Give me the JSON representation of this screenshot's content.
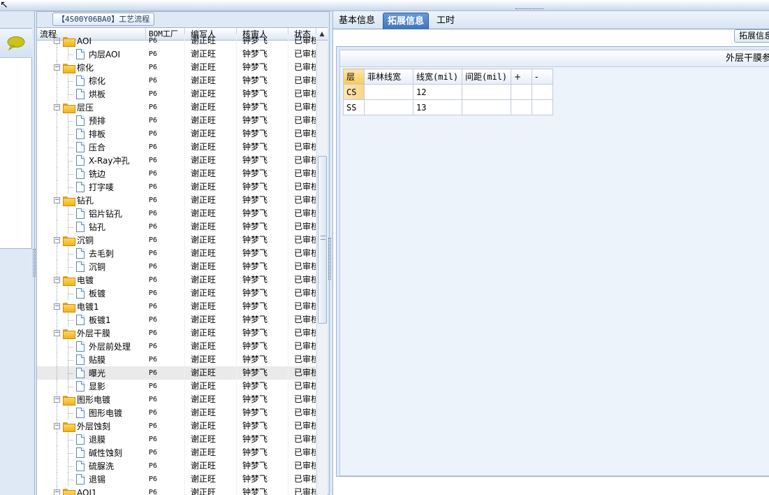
{
  "tree_panel": {
    "title": "【4S00Y06BA0】工艺流程",
    "columns": [
      "流程",
      "BOM工厂",
      "编写人",
      "核审人",
      "状态"
    ],
    "rows": [
      {
        "name": "AOI",
        "level": 0,
        "type": "folder",
        "bom": "P6",
        "writer": "谢正旺",
        "reviewer": "钟梦飞",
        "status": "已审核"
      },
      {
        "name": "内层AOI",
        "level": 1,
        "type": "doc",
        "bom": "P6",
        "writer": "谢正旺",
        "reviewer": "钟梦飞",
        "status": "已审核"
      },
      {
        "name": "棕化",
        "level": 0,
        "type": "folder",
        "bom": "P6",
        "writer": "谢正旺",
        "reviewer": "钟梦飞",
        "status": "已审核"
      },
      {
        "name": "棕化",
        "level": 1,
        "type": "doc",
        "bom": "P6",
        "writer": "谢正旺",
        "reviewer": "钟梦飞",
        "status": "已审核"
      },
      {
        "name": "烘板",
        "level": 1,
        "type": "doc",
        "bom": "P6",
        "writer": "谢正旺",
        "reviewer": "钟梦飞",
        "status": "已审核"
      },
      {
        "name": "层压",
        "level": 0,
        "type": "folder",
        "bom": "P6",
        "writer": "谢正旺",
        "reviewer": "钟梦飞",
        "status": "已审核"
      },
      {
        "name": "预排",
        "level": 1,
        "type": "doc",
        "bom": "P6",
        "writer": "谢正旺",
        "reviewer": "钟梦飞",
        "status": "已审核"
      },
      {
        "name": "排板",
        "level": 1,
        "type": "doc",
        "bom": "P6",
        "writer": "谢正旺",
        "reviewer": "钟梦飞",
        "status": "已审核"
      },
      {
        "name": "压合",
        "level": 1,
        "type": "doc",
        "bom": "P6",
        "writer": "谢正旺",
        "reviewer": "钟梦飞",
        "status": "已审核"
      },
      {
        "name": "X-Ray冲孔",
        "level": 1,
        "type": "doc",
        "bom": "P6",
        "writer": "谢正旺",
        "reviewer": "钟梦飞",
        "status": "已审核"
      },
      {
        "name": "铣边",
        "level": 1,
        "type": "doc",
        "bom": "P6",
        "writer": "谢正旺",
        "reviewer": "钟梦飞",
        "status": "已审核"
      },
      {
        "name": "打字唛",
        "level": 1,
        "type": "doc",
        "bom": "P6",
        "writer": "谢正旺",
        "reviewer": "钟梦飞",
        "status": "已审核"
      },
      {
        "name": "钻孔",
        "level": 0,
        "type": "folder",
        "bom": "P6",
        "writer": "谢正旺",
        "reviewer": "钟梦飞",
        "status": "已审核"
      },
      {
        "name": "铝片钻孔",
        "level": 1,
        "type": "doc",
        "bom": "P6",
        "writer": "谢正旺",
        "reviewer": "钟梦飞",
        "status": "已审核"
      },
      {
        "name": "钻孔",
        "level": 1,
        "type": "doc",
        "bom": "P6",
        "writer": "谢正旺",
        "reviewer": "钟梦飞",
        "status": "已审核"
      },
      {
        "name": "沉铜",
        "level": 0,
        "type": "folder",
        "bom": "P6",
        "writer": "谢正旺",
        "reviewer": "钟梦飞",
        "status": "已审核"
      },
      {
        "name": "去毛刺",
        "level": 1,
        "type": "doc",
        "bom": "P6",
        "writer": "谢正旺",
        "reviewer": "钟梦飞",
        "status": "已审核"
      },
      {
        "name": "沉铜",
        "level": 1,
        "type": "doc",
        "bom": "P6",
        "writer": "谢正旺",
        "reviewer": "钟梦飞",
        "status": "已审核"
      },
      {
        "name": "电镀",
        "level": 0,
        "type": "folder",
        "bom": "P6",
        "writer": "谢正旺",
        "reviewer": "钟梦飞",
        "status": "已审核"
      },
      {
        "name": "板镀",
        "level": 1,
        "type": "doc",
        "bom": "P6",
        "writer": "谢正旺",
        "reviewer": "钟梦飞",
        "status": "已审核"
      },
      {
        "name": "电镀1",
        "level": 0,
        "type": "folder",
        "bom": "P6",
        "writer": "谢正旺",
        "reviewer": "钟梦飞",
        "status": "已审核"
      },
      {
        "name": "板镀1",
        "level": 1,
        "type": "doc",
        "bom": "P6",
        "writer": "谢正旺",
        "reviewer": "钟梦飞",
        "status": "已审核"
      },
      {
        "name": "外层干膜",
        "level": 0,
        "type": "folder",
        "bom": "P6",
        "writer": "谢正旺",
        "reviewer": "钟梦飞",
        "status": "已审核"
      },
      {
        "name": "外层前处理",
        "level": 1,
        "type": "doc",
        "bom": "P6",
        "writer": "谢正旺",
        "reviewer": "钟梦飞",
        "status": "已审核"
      },
      {
        "name": "贴膜",
        "level": 1,
        "type": "doc",
        "bom": "P6",
        "writer": "谢正旺",
        "reviewer": "钟梦飞",
        "status": "已审核"
      },
      {
        "name": "曝光",
        "level": 1,
        "type": "doc",
        "bom": "P6",
        "writer": "谢正旺",
        "reviewer": "钟梦飞",
        "status": "已审核",
        "highlighted": true
      },
      {
        "name": "显影",
        "level": 1,
        "type": "doc",
        "bom": "P6",
        "writer": "谢正旺",
        "reviewer": "钟梦飞",
        "status": "已审核"
      },
      {
        "name": "图形电镀",
        "level": 0,
        "type": "folder",
        "bom": "P6",
        "writer": "谢正旺",
        "reviewer": "钟梦飞",
        "status": "已审核"
      },
      {
        "name": "图形电镀",
        "level": 1,
        "type": "doc",
        "bom": "P6",
        "writer": "谢正旺",
        "reviewer": "钟梦飞",
        "status": "已审核"
      },
      {
        "name": "外层蚀刻",
        "level": 0,
        "type": "folder",
        "bom": "P6",
        "writer": "谢正旺",
        "reviewer": "钟梦飞",
        "status": "已审核"
      },
      {
        "name": "退膜",
        "level": 1,
        "type": "doc",
        "bom": "P6",
        "writer": "谢正旺",
        "reviewer": "钟梦飞",
        "status": "已审核"
      },
      {
        "name": "碱性蚀刻",
        "level": 1,
        "type": "doc",
        "bom": "P6",
        "writer": "谢正旺",
        "reviewer": "钟梦飞",
        "status": "已审核"
      },
      {
        "name": "硫脲洗",
        "level": 1,
        "type": "doc",
        "bom": "P6",
        "writer": "谢正旺",
        "reviewer": "钟梦飞",
        "status": "已审核"
      },
      {
        "name": "退锡",
        "level": 1,
        "type": "doc",
        "bom": "P6",
        "writer": "谢正旺",
        "reviewer": "钟梦飞",
        "status": "已审核"
      },
      {
        "name": "AOI1",
        "level": 0,
        "type": "folder",
        "bom": "P6",
        "writer": "谢正旺",
        "reviewer": "钟梦飞",
        "status": "已审核"
      }
    ]
  },
  "detail_panel": {
    "tabs": [
      {
        "label": "基本信息",
        "active": false
      },
      {
        "label": "拓展信息",
        "active": true
      },
      {
        "label": "工时",
        "active": false
      }
    ],
    "header_button": "拓展信息",
    "section_title": "外层干膜参",
    "table": {
      "columns": [
        "层",
        "菲林线宽",
        "线宽(mil)",
        "间距(mil)",
        "+",
        "-"
      ],
      "rows": [
        {
          "layer": "CS",
          "film_width": "",
          "line_width": "12",
          "spacing": "",
          "plus": "",
          "minus": "",
          "selected": true
        },
        {
          "layer": "SS",
          "film_width": "",
          "line_width": "13",
          "spacing": "",
          "plus": "",
          "minus": "",
          "selected": false
        }
      ]
    }
  },
  "colors": {
    "panel_bg": "#dfe9f6",
    "active_tab": "#3f74bd",
    "chat_icon": "#c9c415",
    "row_highlight": "#eaeaea"
  },
  "icons": {
    "chat": "speech-bubble-icon",
    "folder": "folder-icon",
    "doc": "document-icon"
  }
}
